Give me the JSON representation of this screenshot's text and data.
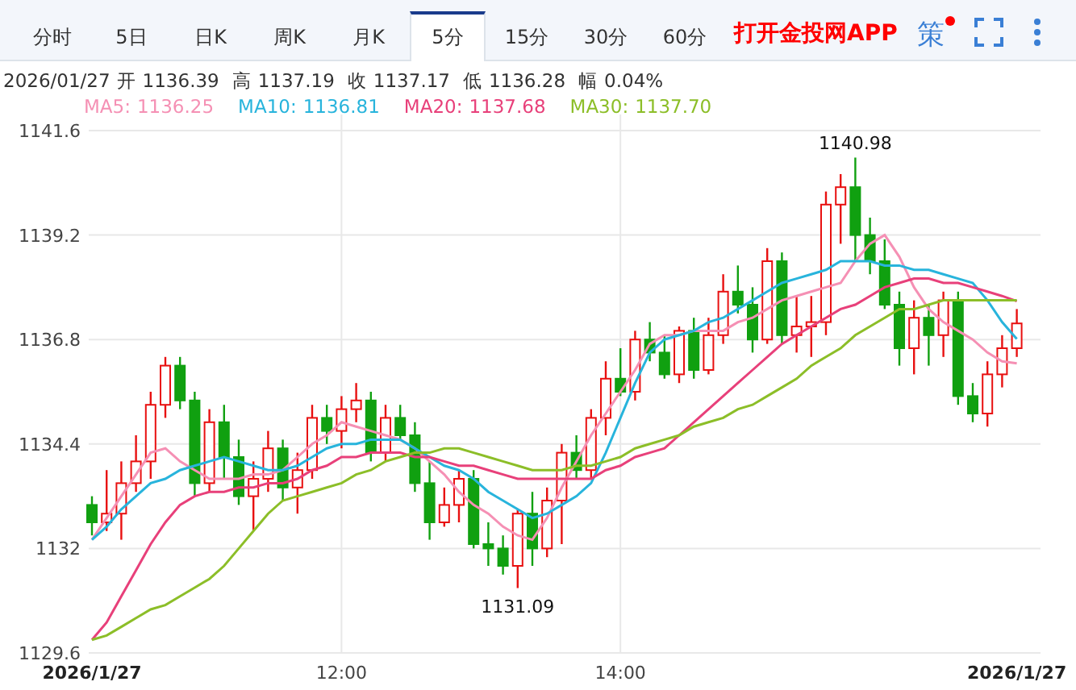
{
  "tabs": [
    {
      "label": "分时",
      "selected": false
    },
    {
      "label": "5日",
      "selected": false
    },
    {
      "label": "日K",
      "selected": false
    },
    {
      "label": "周K",
      "selected": false
    },
    {
      "label": "月K",
      "selected": false
    },
    {
      "label": "5分",
      "selected": true
    },
    {
      "label": "15分",
      "selected": false
    },
    {
      "label": "30分",
      "selected": false
    },
    {
      "label": "60分",
      "selected": false
    }
  ],
  "app_link": "打开金投网APP",
  "strategy_button": {
    "label": "策",
    "notification": true
  },
  "quote": [
    {
      "label": "2026/01/27"
    },
    {
      "label": "开",
      "value": "1136.39"
    },
    {
      "label": "高",
      "value": "1137.19"
    },
    {
      "label": "收",
      "value": "1137.17"
    },
    {
      "label": "低",
      "value": "1136.28"
    },
    {
      "label": "幅",
      "value": "0.04%"
    }
  ],
  "legend_values": [
    "1136.25",
    "1136.81",
    "1137.68",
    "1137.70"
  ],
  "chart": {
    "chart_data": {
      "type": "candlestick",
      "categories": [
        "2026/1/27",
        null,
        null,
        null,
        null,
        null,
        null,
        null,
        null,
        null,
        null,
        null,
        null,
        null,
        null,
        null,
        null,
        "12:00",
        null,
        null,
        null,
        null,
        null,
        null,
        null,
        null,
        null,
        null,
        null,
        null,
        null,
        null,
        null,
        null,
        null,
        null,
        "14:00",
        null,
        null,
        null,
        null,
        null,
        null,
        null,
        null,
        null,
        null,
        null,
        null,
        null,
        null,
        null,
        null,
        null,
        null,
        null,
        null,
        null,
        null,
        null,
        null,
        null,
        null,
        "2026/1/27"
      ],
      "grid": true,
      "ylim": [
        1129.6,
        1141.6
      ],
      "yticks": [
        1129.6,
        1132,
        1134.4,
        1136.8,
        1139.2,
        1141.6
      ],
      "ohlc": [
        [
          1133.0,
          1133.2,
          1132.3,
          1132.6
        ],
        [
          1132.6,
          1133.8,
          1132.4,
          1132.8
        ],
        [
          1132.8,
          1134.0,
          1132.2,
          1133.5
        ],
        [
          1133.5,
          1134.6,
          1133.3,
          1134.0
        ],
        [
          1134.0,
          1135.6,
          1133.6,
          1135.3
        ],
        [
          1135.3,
          1136.4,
          1135.0,
          1136.2
        ],
        [
          1136.2,
          1136.4,
          1135.2,
          1135.4
        ],
        [
          1135.4,
          1135.6,
          1133.2,
          1133.5
        ],
        [
          1133.5,
          1135.2,
          1133.3,
          1134.9
        ],
        [
          1134.9,
          1135.3,
          1133.6,
          1134.1
        ],
        [
          1134.1,
          1134.5,
          1133.0,
          1133.2
        ],
        [
          1133.2,
          1134.0,
          1132.4,
          1133.6
        ],
        [
          1133.6,
          1134.7,
          1133.3,
          1134.3
        ],
        [
          1134.3,
          1134.5,
          1133.1,
          1133.4
        ],
        [
          1133.4,
          1134.2,
          1132.8,
          1133.8
        ],
        [
          1133.8,
          1135.3,
          1133.6,
          1135.0
        ],
        [
          1135.0,
          1135.3,
          1134.4,
          1134.7
        ],
        [
          1134.7,
          1135.5,
          1134.3,
          1135.2
        ],
        [
          1135.2,
          1135.8,
          1134.9,
          1135.4
        ],
        [
          1135.4,
          1135.6,
          1134.0,
          1134.2
        ],
        [
          1134.2,
          1135.3,
          1134.0,
          1135.0
        ],
        [
          1135.0,
          1135.3,
          1134.5,
          1134.6
        ],
        [
          1134.6,
          1134.9,
          1133.3,
          1133.5
        ],
        [
          1133.5,
          1134.0,
          1132.2,
          1132.6
        ],
        [
          1132.6,
          1133.4,
          1132.5,
          1133.0
        ],
        [
          1133.0,
          1133.8,
          1132.6,
          1133.6
        ],
        [
          1133.6,
          1133.8,
          1132.0,
          1132.1
        ],
        [
          1132.1,
          1132.6,
          1131.6,
          1132.0
        ],
        [
          1132.0,
          1132.3,
          1131.4,
          1131.6
        ],
        [
          1131.6,
          1132.9,
          1131.09,
          1132.8
        ],
        [
          1132.8,
          1133.3,
          1131.6,
          1132.0
        ],
        [
          1132.0,
          1133.4,
          1131.8,
          1133.1
        ],
        [
          1133.1,
          1134.4,
          1132.1,
          1134.2
        ],
        [
          1134.2,
          1134.6,
          1133.6,
          1133.8
        ],
        [
          1133.8,
          1135.2,
          1133.6,
          1135.0
        ],
        [
          1135.0,
          1136.3,
          1134.6,
          1135.9
        ],
        [
          1135.9,
          1136.6,
          1135.5,
          1135.6
        ],
        [
          1135.6,
          1137.0,
          1135.4,
          1136.8
        ],
        [
          1136.8,
          1137.2,
          1136.3,
          1136.5
        ],
        [
          1136.5,
          1136.9,
          1135.9,
          1136.0
        ],
        [
          1136.0,
          1137.1,
          1135.8,
          1137.0
        ],
        [
          1137.0,
          1137.3,
          1135.9,
          1136.1
        ],
        [
          1136.1,
          1137.3,
          1136.0,
          1136.9
        ],
        [
          1136.9,
          1138.3,
          1136.7,
          1137.9
        ],
        [
          1137.9,
          1138.5,
          1137.4,
          1137.6
        ],
        [
          1137.6,
          1138.0,
          1136.5,
          1136.8
        ],
        [
          1136.8,
          1138.9,
          1136.7,
          1138.6
        ],
        [
          1138.6,
          1138.8,
          1136.7,
          1136.9
        ],
        [
          1136.9,
          1137.8,
          1136.5,
          1137.1
        ],
        [
          1137.1,
          1137.8,
          1136.4,
          1137.2
        ],
        [
          1137.2,
          1140.2,
          1136.9,
          1139.9
        ],
        [
          1139.9,
          1140.6,
          1139.0,
          1140.3
        ],
        [
          1140.3,
          1140.98,
          1138.6,
          1139.2
        ],
        [
          1139.2,
          1139.6,
          1138.3,
          1138.6
        ],
        [
          1138.6,
          1139.1,
          1137.5,
          1137.6
        ],
        [
          1137.6,
          1137.9,
          1136.2,
          1136.6
        ],
        [
          1136.6,
          1137.7,
          1136.0,
          1137.3
        ],
        [
          1137.3,
          1137.6,
          1136.2,
          1136.9
        ],
        [
          1136.9,
          1137.9,
          1136.4,
          1137.7
        ],
        [
          1137.7,
          1137.9,
          1135.3,
          1135.5
        ],
        [
          1135.5,
          1135.8,
          1134.9,
          1135.1
        ],
        [
          1135.1,
          1136.3,
          1134.8,
          1136.0
        ],
        [
          1136.0,
          1136.9,
          1135.7,
          1136.6
        ],
        [
          1136.6,
          1137.5,
          1136.4,
          1137.17
        ]
      ],
      "series": [
        {
          "name": "MA5:",
          "type": "line",
          "color": "#f590b4",
          "values": [
            1132.2,
            1132.7,
            1133.2,
            1133.7,
            1134.2,
            1134.3,
            1134.0,
            1133.8,
            1133.6,
            1133.6,
            1133.6,
            1133.7,
            1133.7,
            1133.8,
            1134.1,
            1134.4,
            1134.6,
            1134.9,
            1134.8,
            1134.7,
            1134.6,
            1134.5,
            1134.3,
            1134.0,
            1133.7,
            1133.3,
            1133.0,
            1132.8,
            1132.5,
            1132.3,
            1132.2,
            1132.7,
            1133.4,
            1134.0,
            1134.6,
            1135.1,
            1135.6,
            1136.1,
            1136.7,
            1136.9,
            1136.9,
            1137.0,
            1137.0,
            1137.0,
            1137.2,
            1137.3,
            1137.5,
            1137.7,
            1137.8,
            1137.9,
            1138.0,
            1138.1,
            1138.6,
            1139.0,
            1139.2,
            1138.7,
            1138.0,
            1137.5,
            1137.2,
            1137.0,
            1136.8,
            1136.5,
            1136.3,
            1136.25
          ]
        },
        {
          "name": "MA10:",
          "type": "line",
          "color": "#28b4dc",
          "values": [
            1132.2,
            1132.5,
            1132.9,
            1133.2,
            1133.5,
            1133.6,
            1133.8,
            1133.9,
            1134.0,
            1134.1,
            1134.0,
            1133.9,
            1133.8,
            1133.8,
            1133.9,
            1134.1,
            1134.3,
            1134.4,
            1134.4,
            1134.5,
            1134.5,
            1134.5,
            1134.3,
            1134.1,
            1133.9,
            1133.8,
            1133.6,
            1133.3,
            1133.1,
            1132.9,
            1132.7,
            1132.8,
            1133.0,
            1133.2,
            1133.5,
            1134.2,
            1135.0,
            1135.8,
            1136.5,
            1136.8,
            1136.9,
            1137.0,
            1137.2,
            1137.3,
            1137.5,
            1137.7,
            1137.9,
            1138.1,
            1138.2,
            1138.3,
            1138.4,
            1138.6,
            1138.6,
            1138.6,
            1138.5,
            1138.5,
            1138.4,
            1138.4,
            1138.3,
            1138.2,
            1138.1,
            1137.7,
            1137.2,
            1136.81
          ]
        },
        {
          "name": "MA20:",
          "type": "line",
          "color": "#e8407a",
          "values": [
            1129.9,
            1130.3,
            1130.9,
            1131.5,
            1132.1,
            1132.6,
            1133.0,
            1133.2,
            1133.3,
            1133.3,
            1133.4,
            1133.4,
            1133.5,
            1133.5,
            1133.6,
            1133.8,
            1133.9,
            1134.1,
            1134.1,
            1134.2,
            1134.2,
            1134.2,
            1134.1,
            1134.1,
            1134.0,
            1133.9,
            1133.9,
            1133.8,
            1133.7,
            1133.6,
            1133.6,
            1133.6,
            1133.6,
            1133.6,
            1133.6,
            1133.8,
            1133.9,
            1134.1,
            1134.2,
            1134.3,
            1134.6,
            1134.9,
            1135.2,
            1135.5,
            1135.8,
            1136.1,
            1136.4,
            1136.7,
            1136.9,
            1137.1,
            1137.3,
            1137.5,
            1137.6,
            1137.8,
            1138.0,
            1138.1,
            1138.2,
            1138.2,
            1138.1,
            1138.1,
            1138.0,
            1137.9,
            1137.8,
            1137.68
          ]
        },
        {
          "name": "MA30:",
          "type": "line",
          "color": "#8cbe28",
          "values": [
            1129.9,
            1130.0,
            1130.2,
            1130.4,
            1130.6,
            1130.7,
            1130.9,
            1131.1,
            1131.3,
            1131.6,
            1132.0,
            1132.4,
            1132.8,
            1133.1,
            1133.2,
            1133.3,
            1133.4,
            1133.5,
            1133.7,
            1133.8,
            1134.0,
            1134.1,
            1134.2,
            1134.2,
            1134.3,
            1134.3,
            1134.2,
            1134.1,
            1134.0,
            1133.9,
            1133.8,
            1133.8,
            1133.8,
            1133.9,
            1133.9,
            1134.0,
            1134.1,
            1134.3,
            1134.4,
            1134.5,
            1134.6,
            1134.8,
            1134.9,
            1135.0,
            1135.2,
            1135.3,
            1135.5,
            1135.7,
            1135.9,
            1136.2,
            1136.4,
            1136.6,
            1136.9,
            1137.1,
            1137.3,
            1137.5,
            1137.5,
            1137.6,
            1137.7,
            1137.7,
            1137.7,
            1137.7,
            1137.7,
            1137.7
          ]
        }
      ],
      "annotations": [
        "1140.98",
        "1131.09"
      ]
    }
  }
}
